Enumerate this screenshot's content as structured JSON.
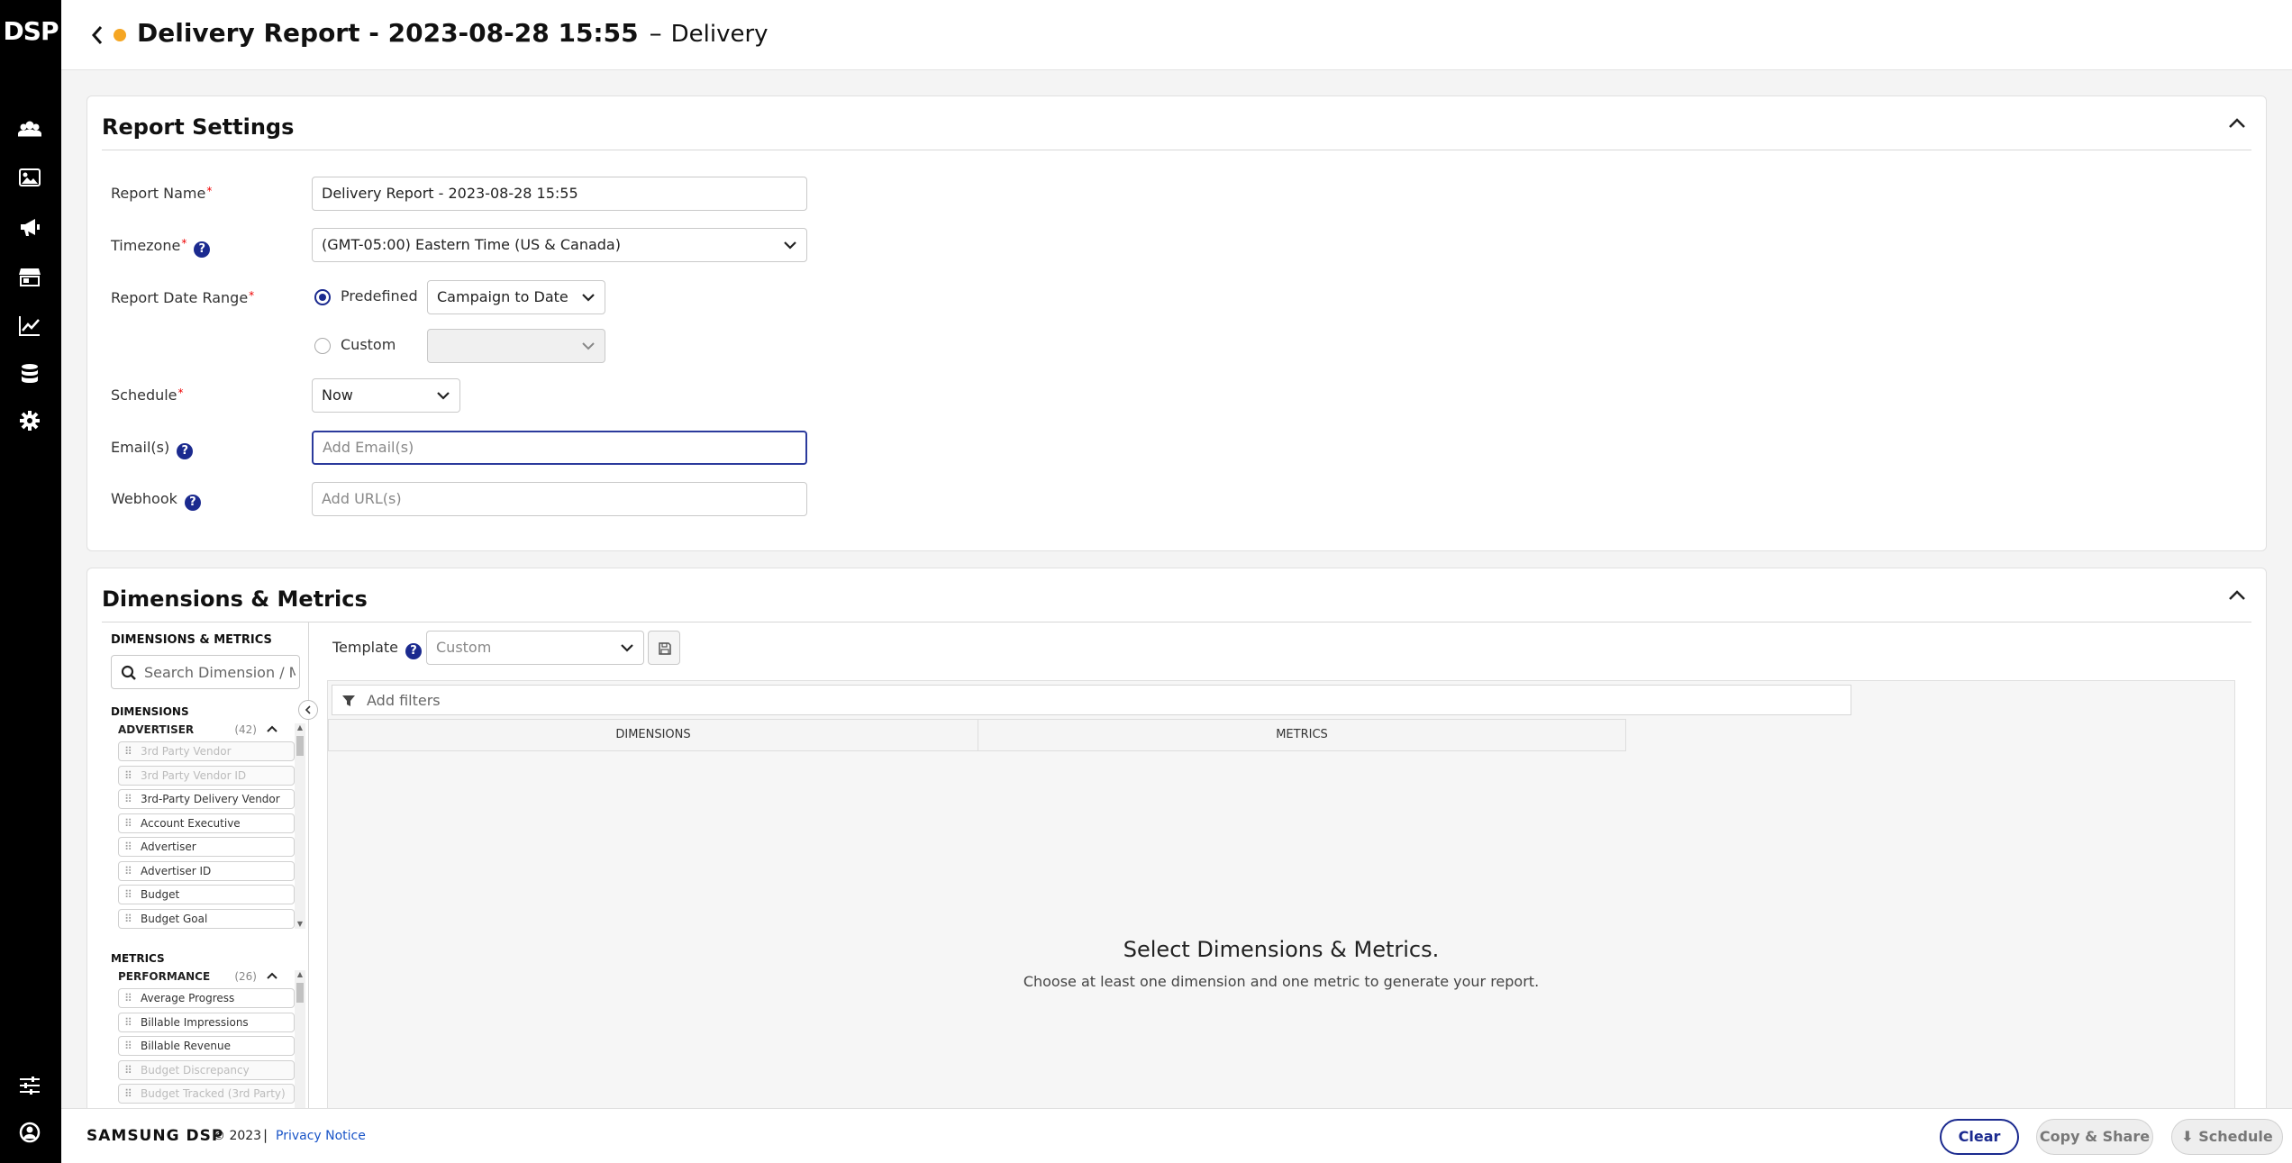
{
  "app": {
    "logo": "DSP"
  },
  "header": {
    "title": "Delivery Report - 2023-08-28 15:55",
    "separator": "–",
    "subtitle": "Delivery",
    "status_color": "#f5a623"
  },
  "nav": {
    "icons": [
      "users-icon",
      "image-icon",
      "megaphone-icon",
      "store-icon",
      "chart-line-icon",
      "database-icon",
      "gear-icon",
      "sliders-icon",
      "user-circle-icon"
    ]
  },
  "report_settings": {
    "title": "Report Settings",
    "report_name": {
      "label": "Report Name",
      "value": "Delivery Report - 2023-08-28 15:55"
    },
    "timezone": {
      "label": "Timezone",
      "value": "(GMT-05:00) Eastern Time (US & Canada)"
    },
    "date_range": {
      "label": "Report Date Range",
      "predefined_label": "Predefined",
      "predefined_value": "Campaign to Date",
      "custom_label": "Custom",
      "custom_value": ""
    },
    "schedule": {
      "label": "Schedule",
      "value": "Now"
    },
    "emails": {
      "label": "Email(s)",
      "placeholder": "Add Email(s)"
    },
    "webhook": {
      "label": "Webhook",
      "placeholder": "Add URL(s)"
    },
    "required_mark": "*",
    "help_mark": "?"
  },
  "dimensions_metrics": {
    "title": "Dimensions & Metrics",
    "sidebar_title": "DIMENSIONS & METRICS",
    "search_placeholder": "Search Dimension / Metric",
    "dimensions_heading": "DIMENSIONS",
    "dimension_group": {
      "name": "ADVERTISER",
      "count": "(42)"
    },
    "dimension_items": [
      {
        "label": "3rd Party Vendor",
        "disabled": true
      },
      {
        "label": "3rd Party Vendor ID",
        "disabled": true
      },
      {
        "label": "3rd-Party Delivery Vendor",
        "disabled": false
      },
      {
        "label": "Account Executive",
        "disabled": false
      },
      {
        "label": "Advertiser",
        "disabled": false
      },
      {
        "label": "Advertiser ID",
        "disabled": false
      },
      {
        "label": "Budget",
        "disabled": false
      },
      {
        "label": "Budget Goal",
        "disabled": false
      }
    ],
    "metrics_heading": "METRICS",
    "metric_group": {
      "name": "PERFORMANCE",
      "count": "(26)"
    },
    "metric_items": [
      {
        "label": "Average Progress",
        "disabled": false
      },
      {
        "label": "Billable Impressions",
        "disabled": false
      },
      {
        "label": "Billable Revenue",
        "disabled": false
      },
      {
        "label": "Budget Discrepancy",
        "disabled": true
      },
      {
        "label": "Budget Tracked (3rd Party)",
        "disabled": true
      }
    ],
    "template": {
      "label": "Template",
      "value": "Custom"
    },
    "filters_placeholder": "Add filters",
    "columns": {
      "dimensions": "DIMENSIONS",
      "metrics": "METRICS"
    },
    "empty": {
      "title": "Select Dimensions & Metrics.",
      "subtitle": "Choose at least one dimension and one metric to generate your report."
    }
  },
  "footer": {
    "brand": "SAMSUNG DSP",
    "copyright": "© 2023",
    "separator": "|",
    "privacy": "Privacy Notice",
    "buttons": {
      "clear": "Clear",
      "copy_share": "Copy & Share",
      "schedule": "Schedule"
    }
  }
}
